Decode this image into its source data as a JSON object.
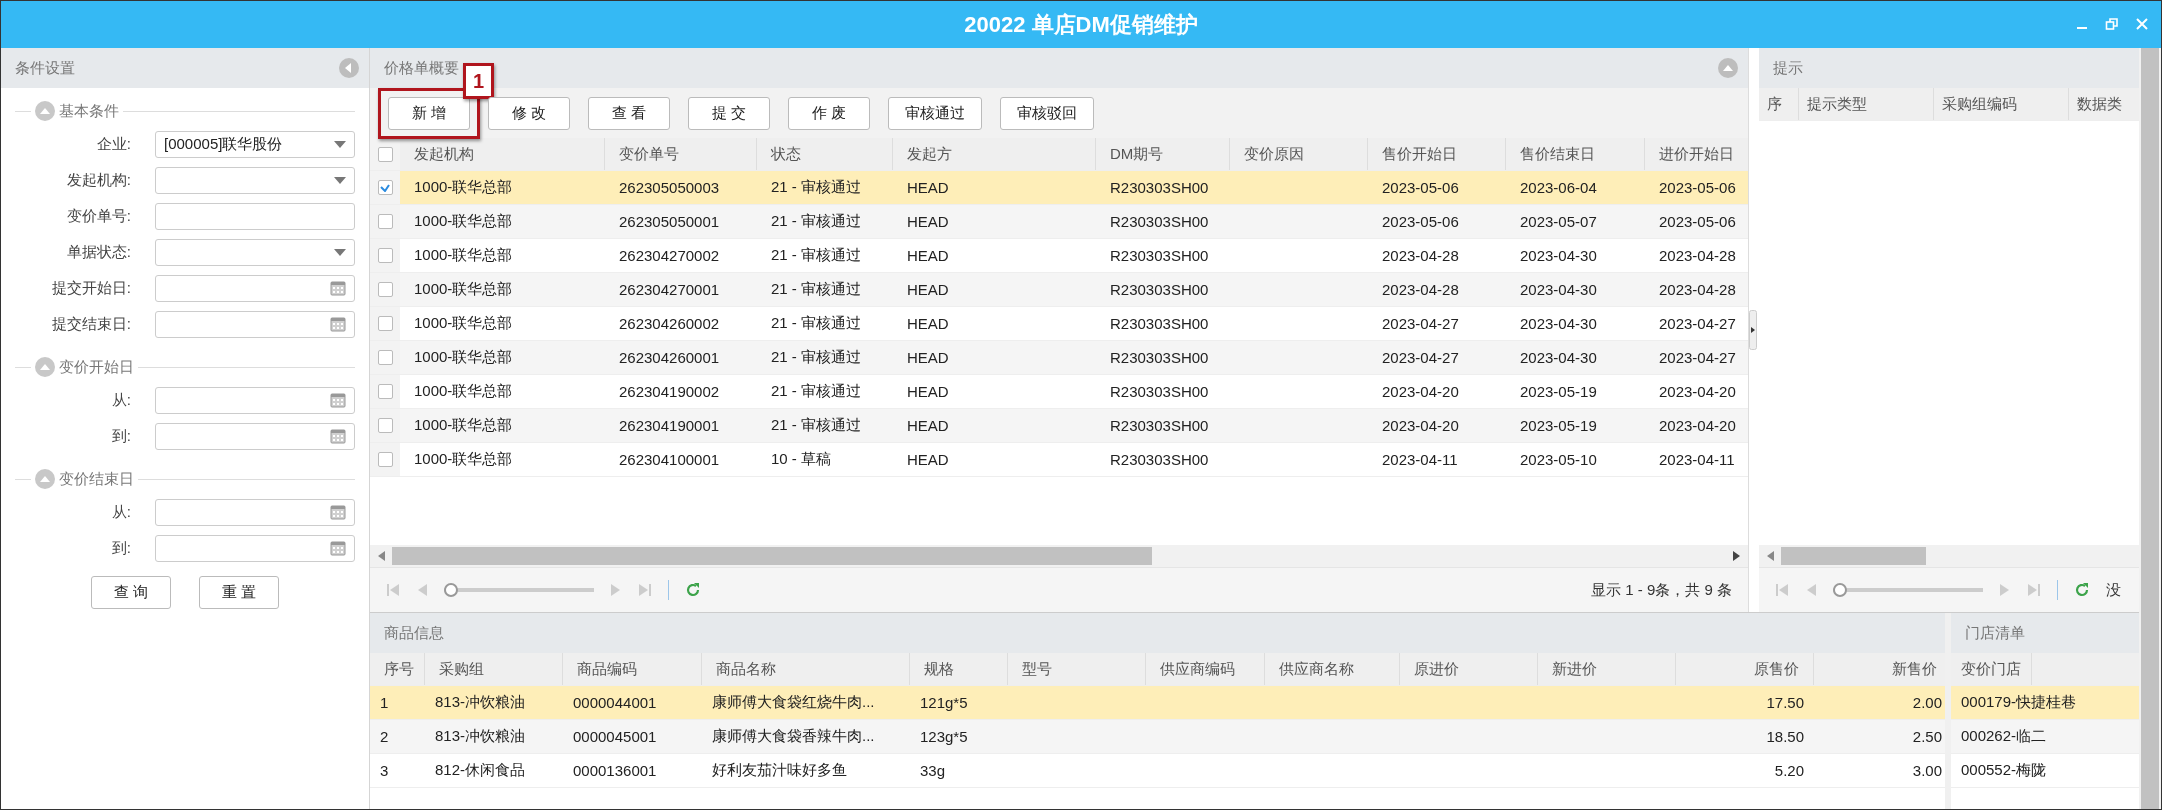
{
  "window": {
    "title": "20022 单店DM促销维护"
  },
  "conditions": {
    "title": "条件设置",
    "sections": [
      {
        "title": "基本条件",
        "fields": [
          {
            "label": "企业:",
            "kind": "select",
            "value": "[000005]联华股份"
          },
          {
            "label": "发起机构:",
            "kind": "select"
          },
          {
            "label": "变价单号:",
            "kind": "text"
          },
          {
            "label": "单据状态:",
            "kind": "select"
          },
          {
            "label": "提交开始日:",
            "kind": "date"
          },
          {
            "label": "提交结束日:",
            "kind": "date"
          }
        ]
      },
      {
        "title": "变价开始日",
        "fields": [
          {
            "label": "从:",
            "kind": "date"
          },
          {
            "label": "到:",
            "kind": "date"
          }
        ]
      },
      {
        "title": "变价结束日",
        "fields": [
          {
            "label": "从:",
            "kind": "date"
          },
          {
            "label": "到:",
            "kind": "date"
          }
        ]
      }
    ],
    "buttons": [
      "查 询",
      "重 置"
    ]
  },
  "summary": {
    "title": "价格单概要",
    "toolbar": [
      {
        "label": "新 增",
        "callout": "1"
      },
      {
        "label": "修 改"
      },
      {
        "label": "查 看"
      },
      {
        "label": "提 交"
      },
      {
        "label": "作 废"
      },
      {
        "label": "审核通过"
      },
      {
        "label": "审核驳回"
      }
    ],
    "all_checked": false,
    "columns": [
      "发起机构",
      "变价单号",
      "状态",
      "发起方",
      "DM期号",
      "变价原因",
      "售价开始日",
      "售价结束日",
      "进价开始日"
    ],
    "rows": [
      {
        "selected": true,
        "checked": true,
        "cells": [
          "1000-联华总部",
          "262305050003",
          "21 - 审核通过",
          "HEAD",
          "R230303SH00",
          "",
          "2023-05-06",
          "2023-06-04",
          "2023-05-06"
        ]
      },
      {
        "selected": false,
        "checked": false,
        "cells": [
          "1000-联华总部",
          "262305050001",
          "21 - 审核通过",
          "HEAD",
          "R230303SH00",
          "",
          "2023-05-06",
          "2023-05-07",
          "2023-05-06"
        ]
      },
      {
        "selected": false,
        "checked": false,
        "cells": [
          "1000-联华总部",
          "262304270002",
          "21 - 审核通过",
          "HEAD",
          "R230303SH00",
          "",
          "2023-04-28",
          "2023-04-30",
          "2023-04-28"
        ]
      },
      {
        "selected": false,
        "checked": false,
        "cells": [
          "1000-联华总部",
          "262304270001",
          "21 - 审核通过",
          "HEAD",
          "R230303SH00",
          "",
          "2023-04-28",
          "2023-04-30",
          "2023-04-28"
        ]
      },
      {
        "selected": false,
        "checked": false,
        "cells": [
          "1000-联华总部",
          "262304260002",
          "21 - 审核通过",
          "HEAD",
          "R230303SH00",
          "",
          "2023-04-27",
          "2023-04-30",
          "2023-04-27"
        ]
      },
      {
        "selected": false,
        "checked": false,
        "cells": [
          "1000-联华总部",
          "262304260001",
          "21 - 审核通过",
          "HEAD",
          "R230303SH00",
          "",
          "2023-04-27",
          "2023-04-30",
          "2023-04-27"
        ]
      },
      {
        "selected": false,
        "checked": false,
        "cells": [
          "1000-联华总部",
          "262304190002",
          "21 - 审核通过",
          "HEAD",
          "R230303SH00",
          "",
          "2023-04-20",
          "2023-05-19",
          "2023-04-20"
        ]
      },
      {
        "selected": false,
        "checked": false,
        "cells": [
          "1000-联华总部",
          "262304190001",
          "21 - 审核通过",
          "HEAD",
          "R230303SH00",
          "",
          "2023-04-20",
          "2023-05-19",
          "2023-04-20"
        ]
      },
      {
        "selected": false,
        "checked": false,
        "cells": [
          "1000-联华总部",
          "262304100001",
          "10 - 草稿",
          "HEAD",
          "R230303SH00",
          "",
          "2023-04-11",
          "2023-05-10",
          "2023-04-11"
        ]
      }
    ],
    "pager": {
      "level": 0,
      "info": "显示 1 - 9条，共 9 条"
    }
  },
  "hints": {
    "title": "提示",
    "columns": [
      "序",
      "提示类型",
      "采购组编码",
      "数据类"
    ],
    "pager": {
      "level": 0,
      "info": "没"
    }
  },
  "goods": {
    "title": "商品信息",
    "columns": [
      "序号",
      "采购组",
      "商品编码",
      "商品名称",
      "规格",
      "型号",
      "供应商编码",
      "供应商名称",
      "原进价",
      "新进价",
      "原售价",
      "新售价"
    ],
    "rows": [
      {
        "selected": true,
        "cells": [
          "1",
          "813-冲饮粮油",
          "0000044001",
          "康师傅大食袋红烧牛肉...",
          "121g*5",
          null,
          null,
          null,
          null,
          null,
          "17.50",
          "2.00"
        ]
      },
      {
        "selected": false,
        "cells": [
          "2",
          "813-冲饮粮油",
          "0000045001",
          "康师傅大食袋香辣牛肉...",
          "123g*5",
          null,
          null,
          null,
          null,
          null,
          "18.50",
          "2.50"
        ]
      },
      {
        "selected": false,
        "cells": [
          "3",
          "812-休闲食品",
          "0000136001",
          "好利友茄汁味好多鱼",
          "33g",
          null,
          null,
          null,
          null,
          null,
          "5.20",
          "3.00"
        ]
      }
    ]
  },
  "stores": {
    "title": "门店清单",
    "column": "变价门店",
    "rows": [
      {
        "selected": true,
        "name": "000179-快捷桂巷"
      },
      {
        "selected": false,
        "name": "000262-临二"
      },
      {
        "selected": false,
        "name": "000552-梅陇"
      }
    ]
  }
}
